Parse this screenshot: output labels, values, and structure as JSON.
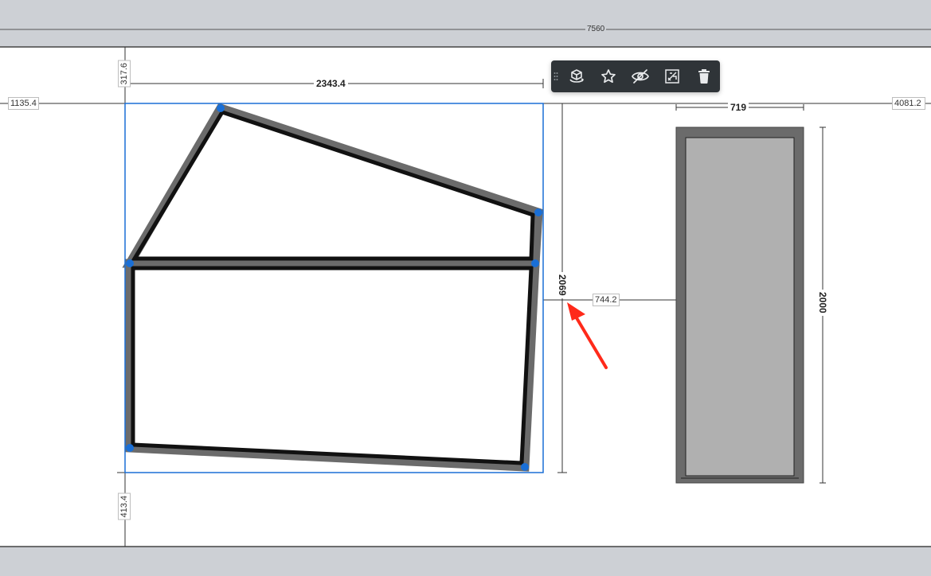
{
  "dimensions": {
    "top_total": "7560",
    "left_offset": "1135.4",
    "right_offset": "4081.2",
    "top_gap": "317.6",
    "bottom_gap": "413.4",
    "shape_width": "2343.4",
    "shape_height": "2069",
    "gap_between": "744.2",
    "door_width": "719",
    "door_height": "2000"
  },
  "toolbar": {
    "buttons": [
      {
        "name": "rotate-3d-button",
        "icon": "rotate-cube-icon"
      },
      {
        "name": "favorite-button",
        "icon": "star-icon"
      },
      {
        "name": "hide-button",
        "icon": "eye-off-icon"
      },
      {
        "name": "replace-button",
        "icon": "image-replace-icon"
      },
      {
        "name": "delete-button",
        "icon": "trash-icon"
      }
    ]
  },
  "colors": {
    "band": "#cdd0d5",
    "selection": "#1a6fd6",
    "handle": "#1a6fd6",
    "wall_outer": "#6b6b6b",
    "wall_inner": "#111111",
    "door_fill": "#b0b0b0",
    "arrow": "#ff2a1a",
    "toolbar_bg": "#2f3438"
  }
}
